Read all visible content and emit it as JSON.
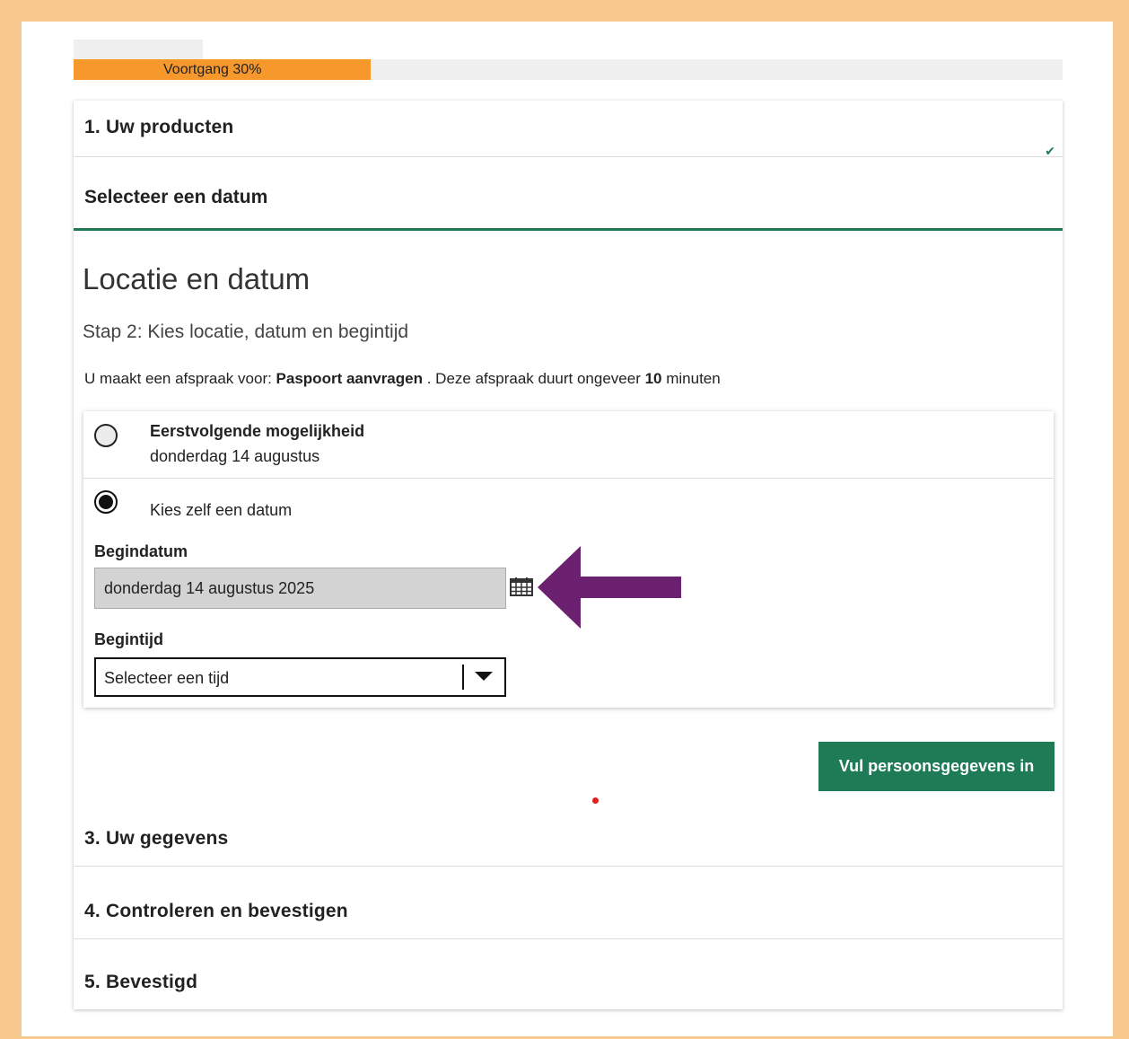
{
  "progress": {
    "label": "Voortgang 30%",
    "percent": 30
  },
  "steps": {
    "step1": {
      "title": "1. Uw producten"
    },
    "step2_sub": {
      "title": "Selecteer een datum"
    },
    "step3": {
      "title": "3. Uw gegevens"
    },
    "step4": {
      "title": "4. Controleren en bevestigen"
    },
    "step5": {
      "title": "5. Bevestigd"
    }
  },
  "main": {
    "heading": "Locatie en datum",
    "subheading": "Stap 2: Kies locatie, datum en begintijd",
    "intro": {
      "prefix": "U maakt een afspraak voor: ",
      "product": "Paspoort aanvragen",
      "middle": " . Deze afspraak duurt ongeveer ",
      "duration": "10",
      "suffix": " minuten"
    },
    "options": {
      "first": {
        "label": "Eerstvolgende mogelijkheid",
        "date": "donderdag 14 augustus",
        "selected": false
      },
      "custom": {
        "label": "Kies zelf een datum",
        "selected": true
      }
    },
    "start_date": {
      "label": "Begindatum",
      "value": "donderdag 14 augustus 2025"
    },
    "start_time": {
      "label": "Begintijd",
      "value": "Selecteer een tijd"
    },
    "next_button": "Vul persoonsgegevens in"
  },
  "colors": {
    "accent": "#1e7b55",
    "progress": "#f7982d",
    "frame": "#f8c98e",
    "annotation_arrow": "#6b2170"
  },
  "icons": {
    "calendar": "calendar-icon",
    "check": "check-icon",
    "dropdown": "chevron-down-icon"
  }
}
